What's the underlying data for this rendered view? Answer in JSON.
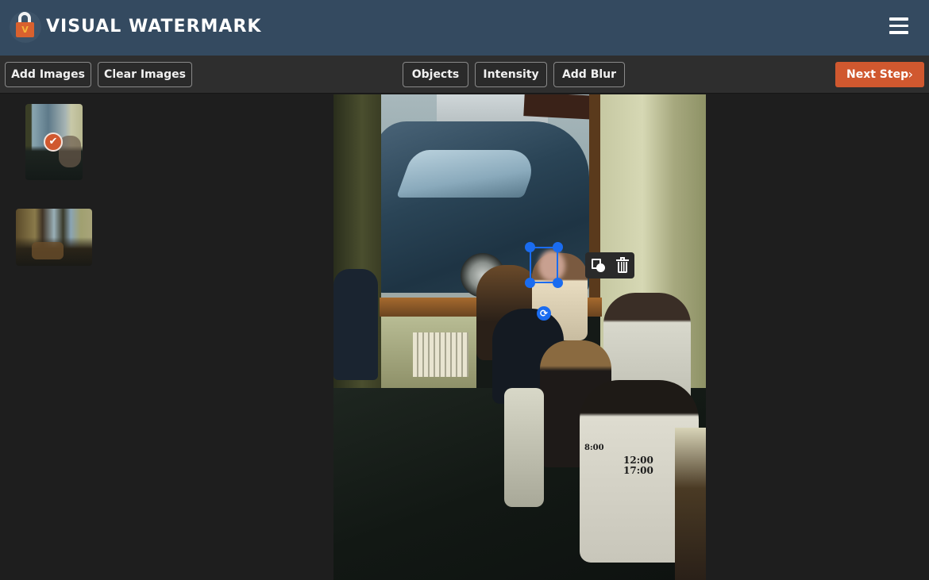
{
  "header": {
    "brand": "VISUAL WATERMARK",
    "logo_letter": "V",
    "menu_icon": "hamburger-menu-icon"
  },
  "toolbar": {
    "add_images": "Add Images",
    "clear_images": "Clear Images",
    "objects": "Objects",
    "intensity": "Intensity",
    "add_blur": "Add Blur",
    "next_step": "Next Step",
    "next_chevron": "›"
  },
  "thumbnails": [
    {
      "label": "image-1",
      "selected": true,
      "check_glyph": "✔"
    },
    {
      "label": "image-2",
      "selected": false
    }
  ],
  "canvas": {
    "photo_text": {
      "shirt_line1": "12:00",
      "shirt_line2": "17:00",
      "shirt_small": "8:00"
    },
    "selection": {
      "rotate_glyph": "⟳",
      "context_menu": [
        "shape-toggle",
        "delete"
      ]
    }
  },
  "colors": {
    "header_bg": "#344a60",
    "toolbar_bg": "#2e2e2e",
    "main_bg": "#1e1e1e",
    "accent": "#d0582f",
    "selection": "#1a6cf0"
  }
}
